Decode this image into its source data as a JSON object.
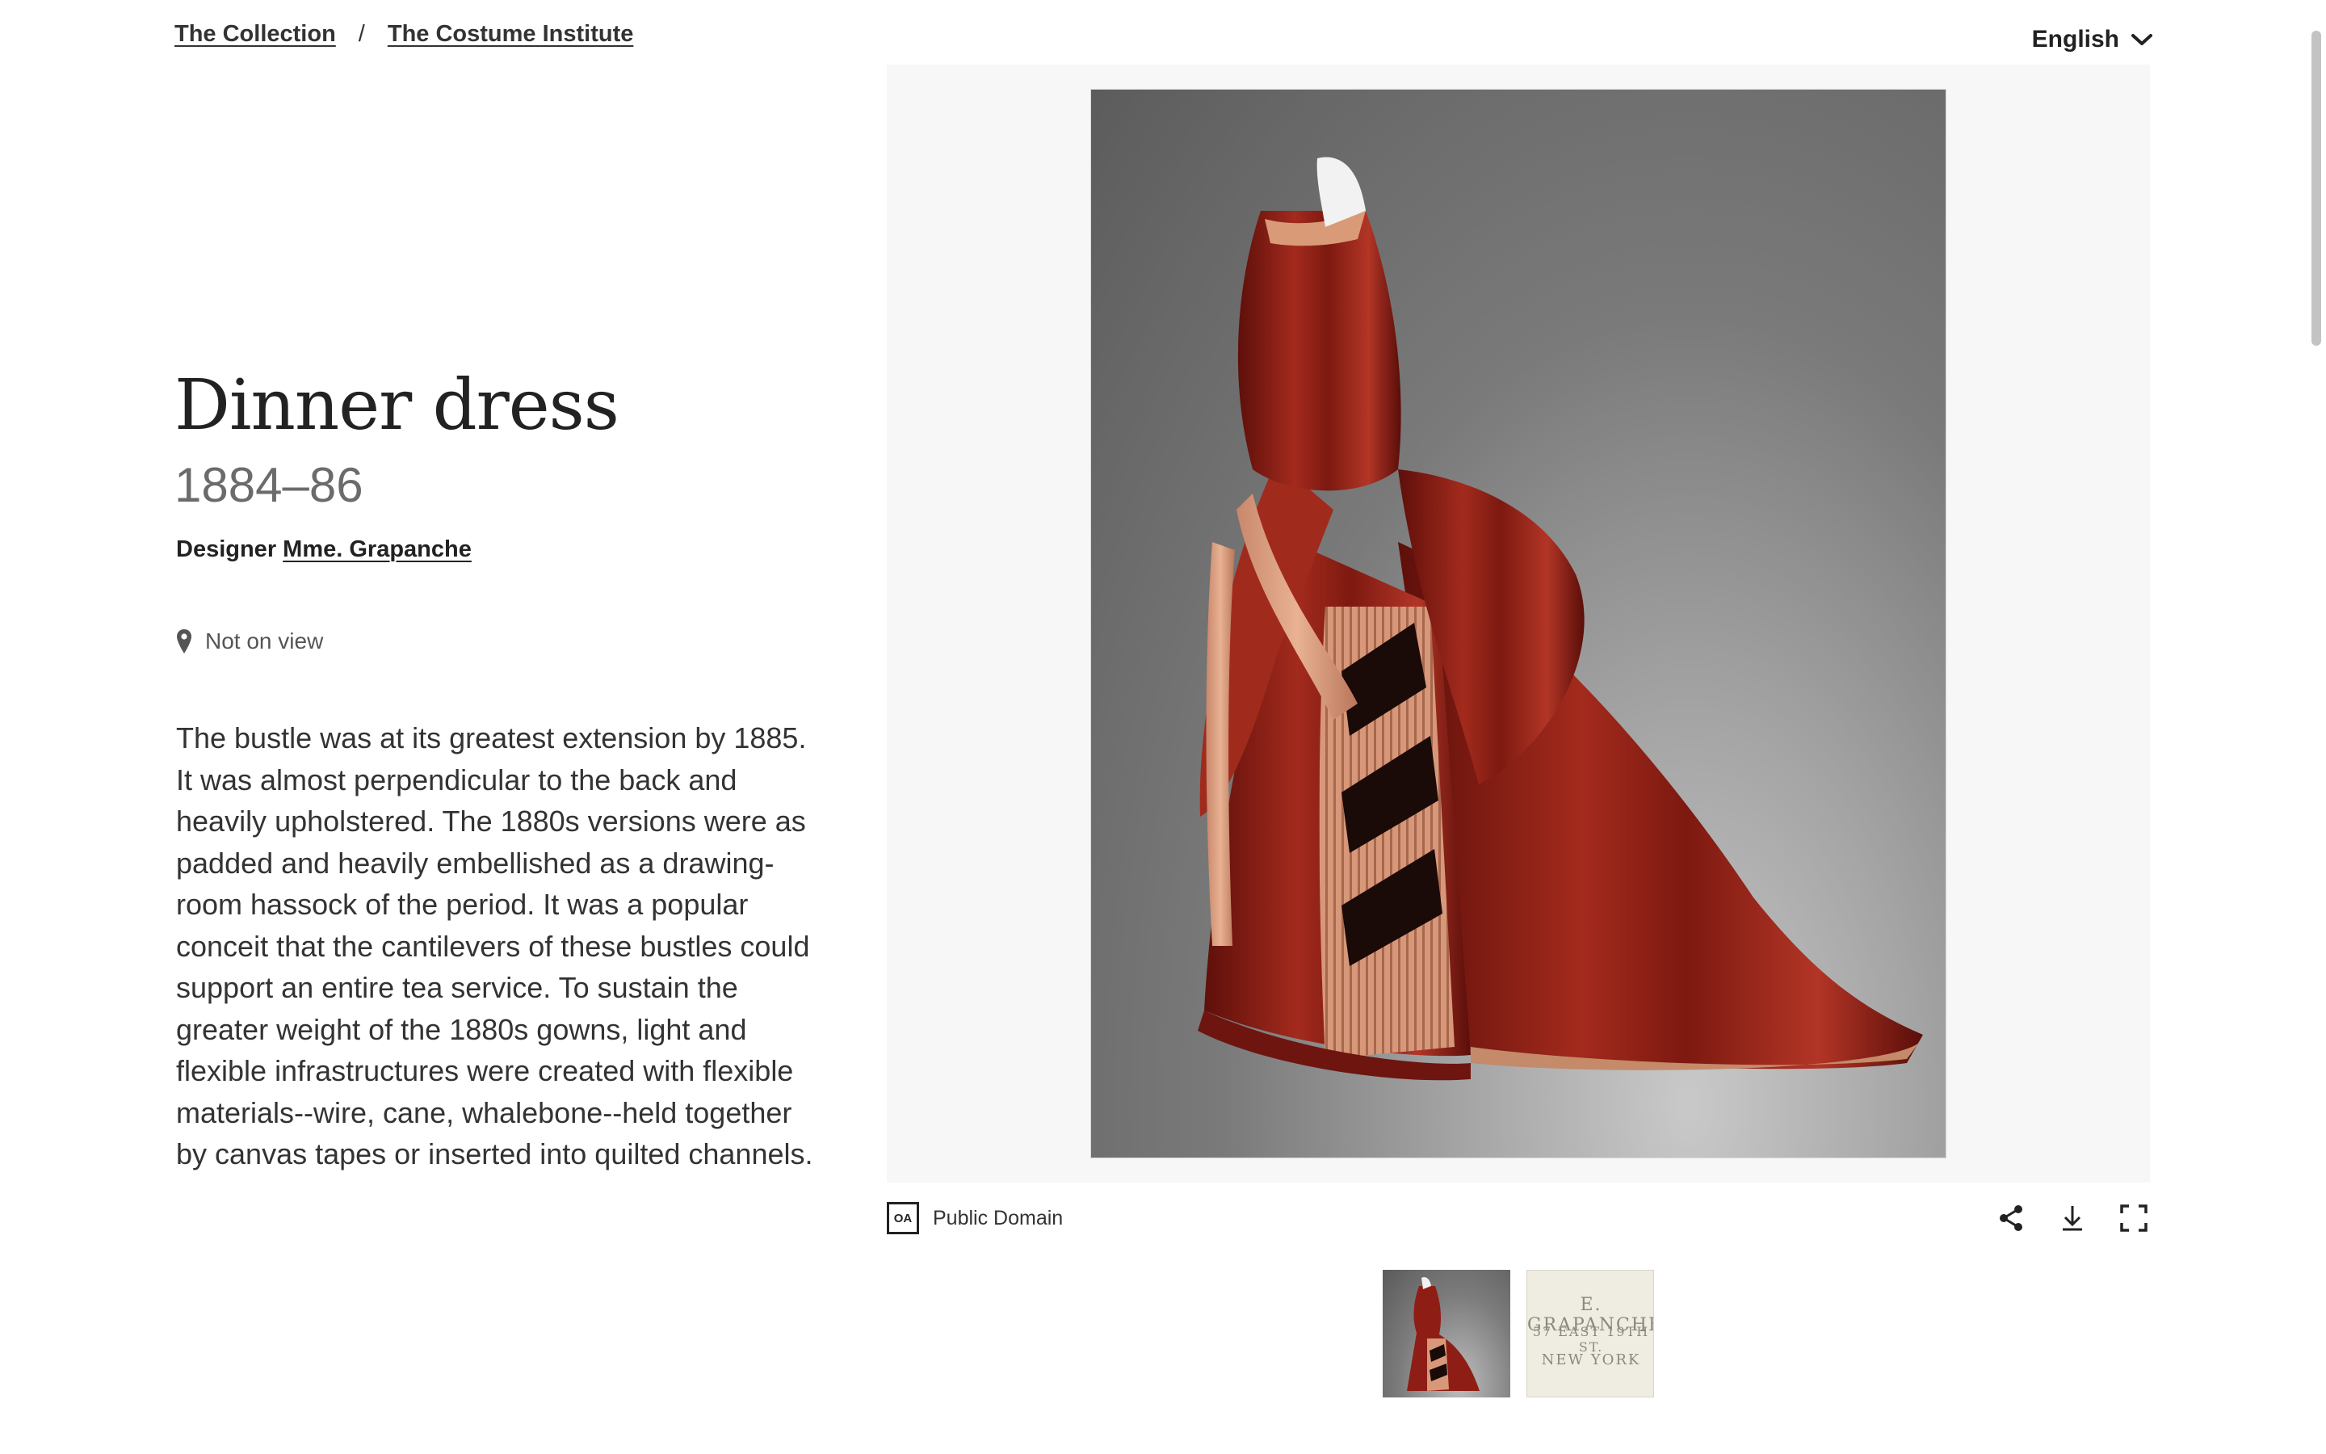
{
  "breadcrumb": {
    "collection": "The Collection",
    "separator": "/",
    "department": "The Costume Institute"
  },
  "language": {
    "selected": "English",
    "icon": "chevron-down-icon"
  },
  "object": {
    "title": "Dinner dress",
    "date": "1884–86",
    "designer_label": "Designer",
    "designer_name": "Mme. Grapanche",
    "location_icon": "map-pin-icon",
    "location": "Not on view",
    "description": "The bustle was at its greatest extension by 1885. It was almost perpendicular to the back and heavily upholstered. The 1880s versions were as padded and heavily embellished as a drawing-room hassock of the period. It was a popular conceit that the cantilevers of these bustles could support an entire tea service. To sustain the greater weight of the 1880s gowns, light and flexible infrastructures were created with flexible materials--wire, cane, whalebone--held together by canvas tapes or inserted into quilted channels."
  },
  "viewer": {
    "license_badge": "OA",
    "license_label": "Public Domain",
    "tools": [
      "share-icon",
      "download-icon",
      "fullscreen-icon"
    ]
  },
  "thumbnails": {
    "label_lines": [
      "E. GRAPANCHE",
      "57 EAST 19TH ST.",
      "NEW YORK"
    ]
  },
  "colors": {
    "dress_red": "#8e1e15",
    "trim_peach": "#d99a78",
    "viewer_bg": "#f7f7f7",
    "text_muted": "#6b6b6b"
  }
}
